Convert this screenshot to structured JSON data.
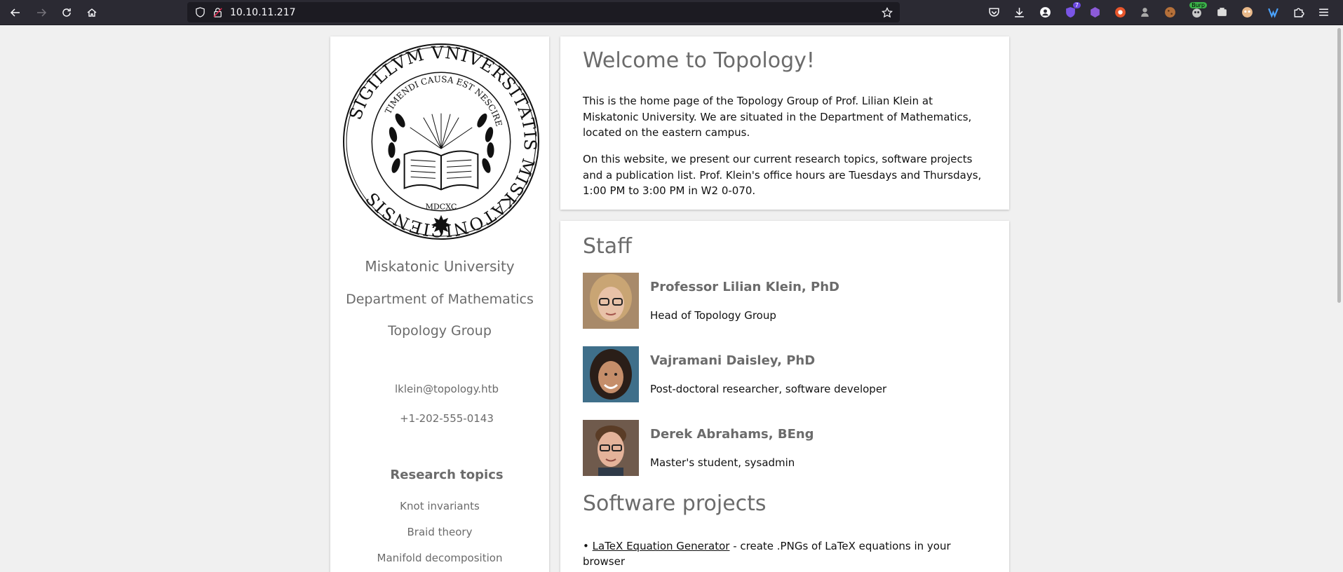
{
  "browser": {
    "url": "10.10.11.217",
    "extensions": [
      {
        "name": "pocket-icon"
      },
      {
        "name": "download-icon"
      },
      {
        "name": "account-icon"
      },
      {
        "name": "extension-ublock-icon",
        "badge": "7"
      },
      {
        "name": "extension-cube-icon"
      },
      {
        "name": "extension-duckduckgo-icon"
      },
      {
        "name": "extension-spy-icon"
      },
      {
        "name": "extension-cookie-icon"
      },
      {
        "name": "extension-burp-icon",
        "badge": "Burp"
      },
      {
        "name": "extension-container-icon"
      },
      {
        "name": "extension-face-icon"
      },
      {
        "name": "extension-wappalyzer-icon"
      },
      {
        "name": "extensions-puzzle-icon"
      },
      {
        "name": "menu-icon"
      }
    ]
  },
  "sidebar": {
    "university": "Miskatonic University",
    "department": "Department of Mathematics",
    "group": "Topology Group",
    "email": "lklein@topology.htb",
    "phone": "+1-202-555-0143",
    "research_heading": "Research topics",
    "topics": [
      "Knot invariants",
      "Braid theory",
      "Manifold decomposition"
    ],
    "seal": {
      "outer_text": "SIGILLVM VNIVERSITATIS MISKATONICIENSIS",
      "inner_text": "TIMENDI CAUSA EST NESCIRE",
      "year": "MDCXC"
    }
  },
  "welcome": {
    "title": "Welcome to Topology!",
    "p1": "This is the home page of the Topology Group of Prof. Lilian Klein at Miskatonic University. We are situated in the Department of Mathematics, located on the eastern campus.",
    "p2": "On this website, we present our current research topics, software projects and a publication list. Prof. Klein's office hours are Tuesdays and Thursdays, 1:00 PM to 3:00 PM in W2 0-070."
  },
  "staff": {
    "title": "Staff",
    "members": [
      {
        "name": "Professor Lilian Klein, PhD",
        "role": "Head of Topology Group"
      },
      {
        "name": "Vajramani Daisley, PhD",
        "role": "Post-doctoral researcher, software developer"
      },
      {
        "name": "Derek Abrahams, BEng",
        "role": "Master's student, sysadmin"
      }
    ]
  },
  "software": {
    "title": "Software projects",
    "bullet": "•",
    "project_link": "LaTeX Equation Generator",
    "project_desc": " - create .PNGs of LaTeX equations in your browser"
  },
  "colors": {
    "toolbar": "#2b2a33",
    "urlbar": "#1c1b22",
    "page_bg": "#f0f0f0",
    "heading_gray": "#6b6b6b"
  }
}
